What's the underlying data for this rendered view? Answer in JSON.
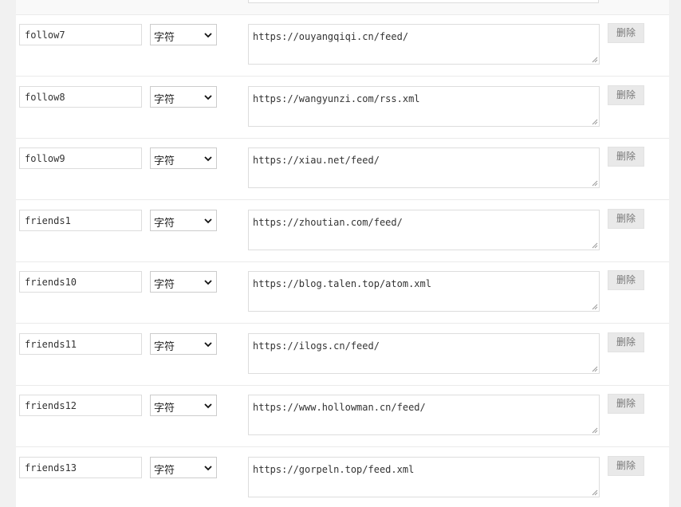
{
  "fields": [
    {
      "name": "follow7",
      "type": "字符",
      "value": "https://ouyangqiqi.cn/feed/"
    },
    {
      "name": "follow8",
      "type": "字符",
      "value": "https://wangyunzi.com/rss.xml"
    },
    {
      "name": "follow9",
      "type": "字符",
      "value": "https://xiau.net/feed/"
    },
    {
      "name": "friends1",
      "type": "字符",
      "value": "https://zhoutian.com/feed/"
    },
    {
      "name": "friends10",
      "type": "字符",
      "value": "https://blog.talen.top/atom.xml"
    },
    {
      "name": "friends11",
      "type": "字符",
      "value": "https://ilogs.cn/feed/"
    },
    {
      "name": "friends12",
      "type": "字符",
      "value": "https://www.hollowman.cn/feed/"
    },
    {
      "name": "friends13",
      "type": "字符",
      "value": "https://gorpeln.top/feed.xml"
    }
  ],
  "delete_label": "删除",
  "icons": {
    "select_arrow": "chevron-down-icon",
    "textarea_resize": "resize-handle-icon"
  }
}
